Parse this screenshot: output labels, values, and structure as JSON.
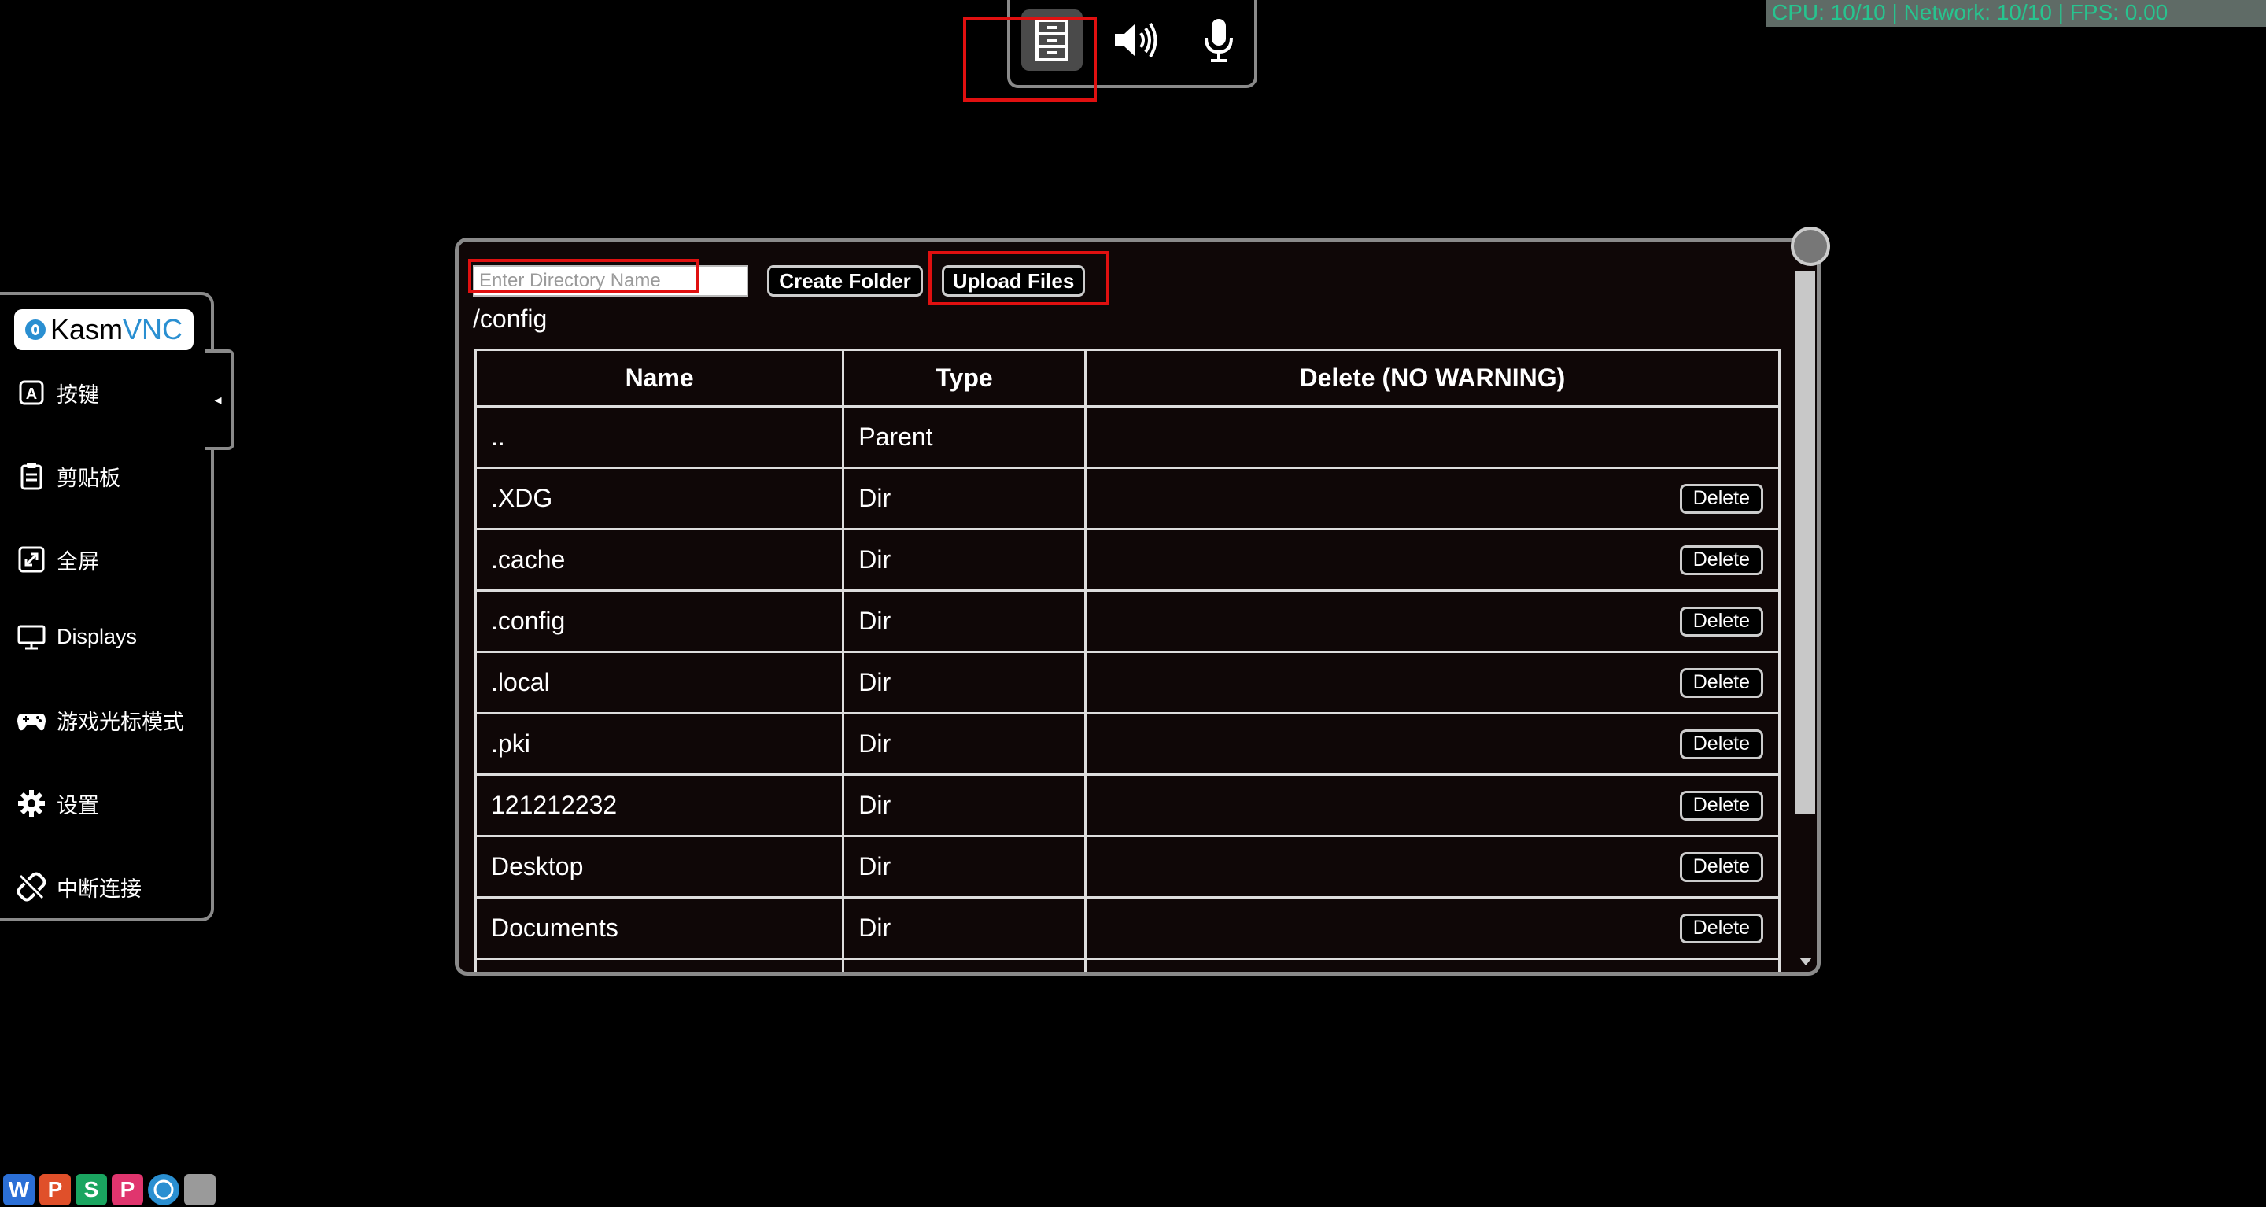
{
  "stats": {
    "text": "CPU: 10/10 | Network: 10/10 | FPS: 0.00"
  },
  "topbar": {
    "files_icon": "file-cabinet-icon",
    "sound_icon": "speaker-icon",
    "mic_icon": "microphone-icon"
  },
  "sidebar": {
    "logo": {
      "part1": "Kasm",
      "part2": "VNC"
    },
    "items": [
      {
        "label": "按键",
        "icon": "keyboard-key-icon"
      },
      {
        "label": "剪贴板",
        "icon": "clipboard-icon"
      },
      {
        "label": "全屏",
        "icon": "fullscreen-icon"
      },
      {
        "label": "Displays",
        "icon": "monitor-icon"
      },
      {
        "label": "游戏光标模式",
        "icon": "gamepad-icon"
      },
      {
        "label": "设置",
        "icon": "gear-icon"
      },
      {
        "label": "中断连接",
        "icon": "disconnect-icon"
      }
    ],
    "handle_glyph": "◂"
  },
  "file_manager": {
    "dir_placeholder": "Enter Directory Name",
    "create_label": "Create Folder",
    "upload_label": "Upload Files",
    "path": "/config",
    "columns": [
      "Name",
      "Type",
      "Delete (NO WARNING)"
    ],
    "delete_label": "Delete",
    "rows": [
      {
        "name": "..",
        "type": "Parent",
        "deletable": false
      },
      {
        "name": ".XDG",
        "type": "Dir",
        "deletable": true
      },
      {
        "name": ".cache",
        "type": "Dir",
        "deletable": true
      },
      {
        "name": ".config",
        "type": "Dir",
        "deletable": true
      },
      {
        "name": ".local",
        "type": "Dir",
        "deletable": true
      },
      {
        "name": ".pki",
        "type": "Dir",
        "deletable": true
      },
      {
        "name": "121212232",
        "type": "Dir",
        "deletable": true
      },
      {
        "name": "Desktop",
        "type": "Dir",
        "deletable": true
      },
      {
        "name": "Documents",
        "type": "Dir",
        "deletable": true
      },
      {
        "name": "",
        "type": "",
        "deletable": true
      }
    ]
  },
  "taskbar": [
    {
      "letter": "W",
      "color": "#2b6fd6",
      "name": "wps-writer-icon"
    },
    {
      "letter": "P",
      "color": "#e0502a",
      "name": "wps-presentation-icon"
    },
    {
      "letter": "S",
      "color": "#1aa560",
      "name": "wps-spreadsheet-icon"
    },
    {
      "letter": "P",
      "color": "#e0356e",
      "name": "wps-pdf-icon"
    },
    {
      "letter": "",
      "color": "#2a8fd1",
      "name": "browser-icon"
    },
    {
      "letter": "",
      "color": "#9a9a9a",
      "name": "app-icon"
    }
  ]
}
